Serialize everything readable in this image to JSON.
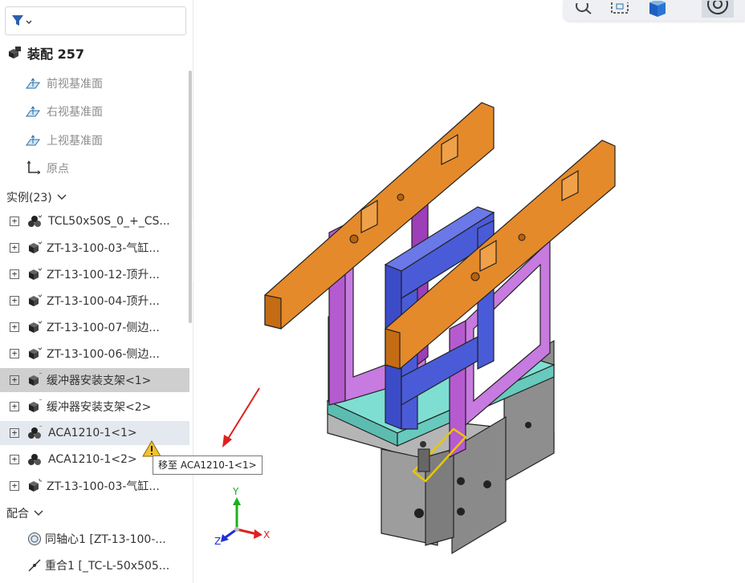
{
  "sidebar": {
    "assembly_title": "装配 257",
    "planes": [
      {
        "label": "前视基准面"
      },
      {
        "label": "右视基准面"
      },
      {
        "label": "上视基准面"
      },
      {
        "label": "原点"
      }
    ],
    "instances_header": "实例(23)",
    "instances": [
      {
        "label": "TCL50x50S_0_+_CS..."
      },
      {
        "label": "ZT-13-100-03-气缸..."
      },
      {
        "label": "ZT-13-100-12-顶升..."
      },
      {
        "label": "ZT-13-100-04-顶升..."
      },
      {
        "label": "ZT-13-100-07-侧边..."
      },
      {
        "label": "ZT-13-100-06-侧边..."
      },
      {
        "label": "缓冲器安装支架<1>"
      },
      {
        "label": "缓冲器安装支架<2>"
      },
      {
        "label": "ACA1210-1<1>"
      },
      {
        "label": "ACA1210-1<2>"
      },
      {
        "label": "ZT-13-100-03-气缸..."
      }
    ],
    "mates_header": "配合",
    "mates": [
      {
        "label": "同轴心1 [ZT-13-100-..."
      },
      {
        "label": "重合1 [_TC-L-50x505..."
      }
    ]
  },
  "tooltip": "移至 ACA1210-1<1>",
  "triad": {
    "x": "X",
    "y": "Y",
    "z": "Z"
  },
  "colors": {
    "orange": "#e58a2a",
    "purple": "#b65ad0",
    "blue": "#4a5bd8",
    "teal": "#7fded2",
    "gray": "#8a8a8a",
    "highlight": "#e8c700",
    "arrow": "#e02020"
  },
  "icons": [
    "filter-icon",
    "assembly-icon",
    "plane-icon",
    "origin-icon",
    "part-icon",
    "subassembly-icon",
    "warning-icon",
    "concentric-icon",
    "coincident-icon"
  ]
}
